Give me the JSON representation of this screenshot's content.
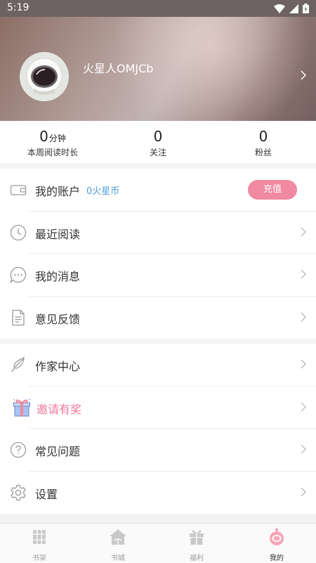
{
  "status_bar": {
    "time": "5:19"
  },
  "profile": {
    "username": "火星人OMJCb"
  },
  "stats": [
    {
      "value": "0",
      "unit": "分钟",
      "label": "本周阅读时长"
    },
    {
      "value": "0",
      "unit": "",
      "label": "关注"
    },
    {
      "value": "0",
      "unit": "",
      "label": "粉丝"
    }
  ],
  "menu_group1": {
    "account": {
      "label": "我的账户",
      "balance": "0火星币",
      "recharge": "充值"
    },
    "recent": {
      "label": "最近阅读"
    },
    "messages": {
      "label": "我的消息"
    },
    "feedback": {
      "label": "意见反馈"
    }
  },
  "menu_group2": {
    "author": {
      "label": "作家中心"
    },
    "invite": {
      "label": "邀请有奖"
    },
    "faq": {
      "label": "常见问题"
    },
    "settings": {
      "label": "设置"
    }
  },
  "tabbar": [
    {
      "label": "书架",
      "active": false
    },
    {
      "label": "书城",
      "active": false
    },
    {
      "label": "福利",
      "active": false
    },
    {
      "label": "我的",
      "active": true
    }
  ],
  "colors": {
    "accent": "#f08aa1",
    "link": "#4b9de0"
  }
}
